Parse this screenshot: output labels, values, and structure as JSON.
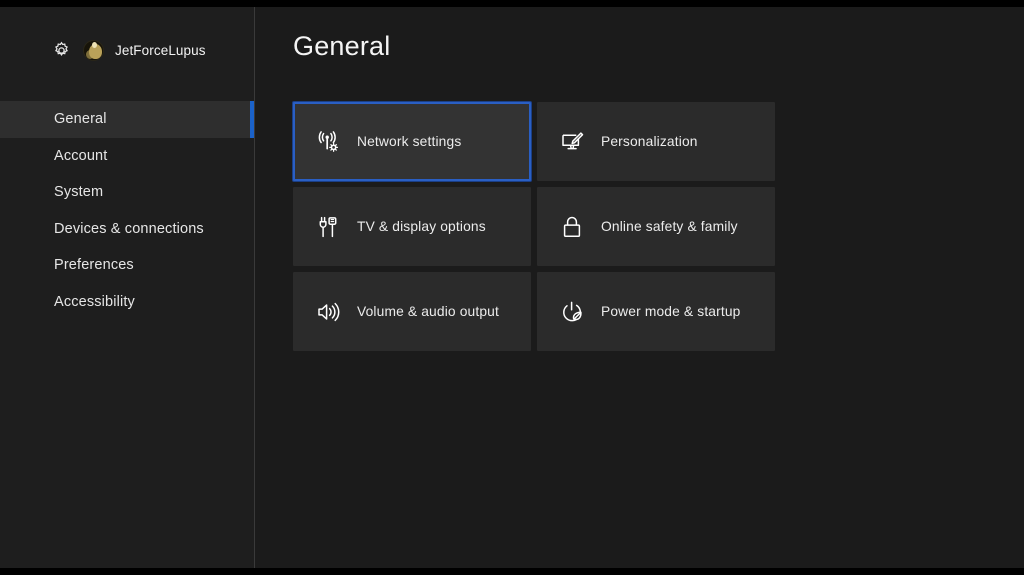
{
  "sidebar": {
    "profile": {
      "settings_icon": "gear-icon",
      "avatar_icon": "user-avatar",
      "gamertag": "JetForceLupus"
    },
    "items": [
      {
        "label": "General",
        "icon": "none",
        "selected": true
      },
      {
        "label": "Account",
        "icon": "none",
        "selected": false
      },
      {
        "label": "System",
        "icon": "none",
        "selected": false
      },
      {
        "label": "Devices & connections",
        "icon": "none",
        "selected": false
      },
      {
        "label": "Preferences",
        "icon": "none",
        "selected": false
      },
      {
        "label": "Accessibility",
        "icon": "none",
        "selected": false
      }
    ]
  },
  "main": {
    "title": "General",
    "tiles": [
      {
        "label": "Network settings",
        "icon": "network-antenna-gear-icon",
        "focused": true
      },
      {
        "label": "Personalization",
        "icon": "monitor-pencil-icon",
        "focused": false
      },
      {
        "label": "TV & display options",
        "icon": "cable-plugs-icon",
        "focused": false
      },
      {
        "label": "Online safety & family",
        "icon": "lock-icon",
        "focused": false
      },
      {
        "label": "Volume & audio output",
        "icon": "speaker-waves-icon",
        "focused": false
      },
      {
        "label": "Power mode & startup",
        "icon": "power-leaf-icon",
        "focused": false
      }
    ]
  },
  "colors": {
    "accent_blue": "#2a5fc4",
    "selection_bar": "#1b62c9",
    "background": "#1b1b1b",
    "sidebar_background": "#1e1e1e",
    "tile_background": "#2b2b2b",
    "tile_focused_background": "#333333",
    "text_primary": "#f2f2f2",
    "letterbox": "#000000"
  }
}
